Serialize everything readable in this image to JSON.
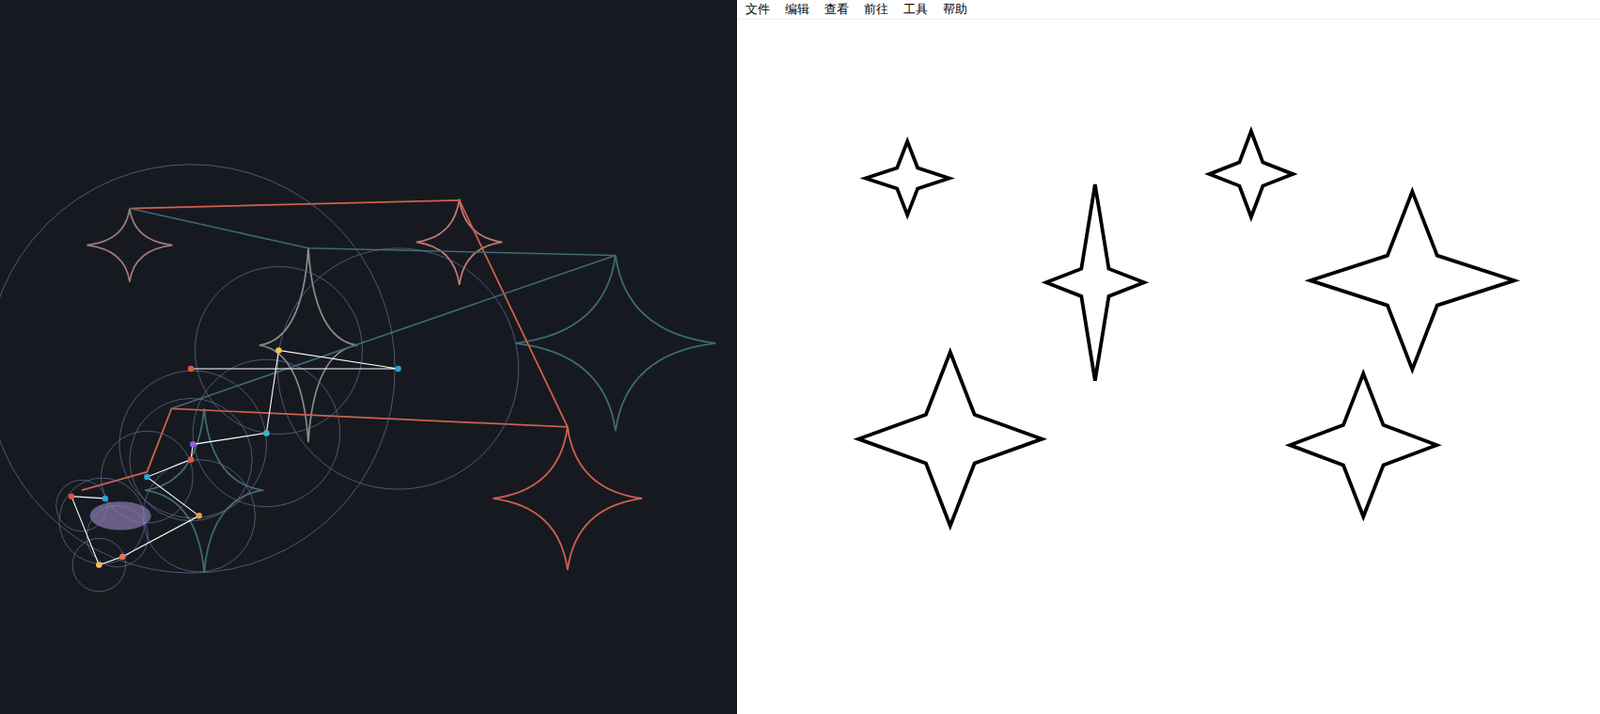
{
  "menu": [
    {
      "label": "文件"
    },
    {
      "label": "编辑"
    },
    {
      "label": "查看"
    },
    {
      "label": "前往"
    },
    {
      "label": "工具"
    },
    {
      "label": "帮助"
    }
  ],
  "epicycles": {
    "traces": [
      {
        "color": "#a07878"
      },
      {
        "color": "#c07a72"
      },
      {
        "color": "#8a8a8a"
      },
      {
        "color": "#3e6b74"
      },
      {
        "color": "#d2604e"
      },
      {
        "color": "#3e6b74"
      }
    ],
    "joints": [
      {
        "color": "#e0563e"
      },
      {
        "color": "#2fa0d8"
      },
      {
        "color": "#f2c14e"
      },
      {
        "color": "#3fb8c8"
      },
      {
        "color": "#9a5ad8"
      },
      {
        "color": "#e0563e"
      },
      {
        "color": "#2fa0d8"
      },
      {
        "color": "#e0a040"
      },
      {
        "color": "#e07850"
      },
      {
        "color": "#f2c14e"
      },
      {
        "color": "#e0563e"
      },
      {
        "color": "#2fa0d8"
      }
    ]
  },
  "canvas": {
    "shapes": [
      {
        "kind": "star"
      },
      {
        "kind": "star"
      },
      {
        "kind": "star"
      },
      {
        "kind": "star"
      },
      {
        "kind": "star"
      },
      {
        "kind": "star"
      }
    ]
  }
}
